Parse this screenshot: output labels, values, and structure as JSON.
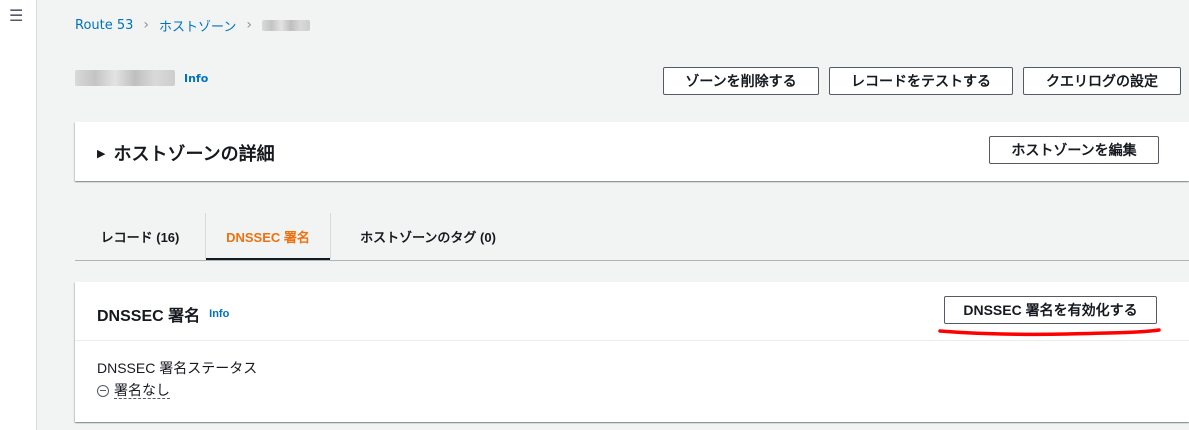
{
  "nav": {
    "menu_icon": "menu-icon"
  },
  "breadcrumb": {
    "items": [
      "Route 53",
      "ホストゾーン"
    ],
    "separator": ">"
  },
  "page": {
    "info_label": "Info"
  },
  "actions": {
    "delete_zone": "ゾーンを削除する",
    "test_record": "レコードをテストする",
    "query_log": "クエリログの設定"
  },
  "details": {
    "title": "ホストゾーンの詳細",
    "edit_button": "ホストゾーンを編集"
  },
  "tabs": [
    {
      "label": "レコード (16)",
      "active": false
    },
    {
      "label": "DNSSEC 署名",
      "active": true
    },
    {
      "label": "ホストゾーンのタグ (0)",
      "active": false
    }
  ],
  "dnssec": {
    "title": "DNSSEC 署名",
    "info_label": "Info",
    "enable_button": "DNSSEC 署名を有効化する",
    "status_label": "DNSSEC 署名ステータス",
    "status_value": "署名なし",
    "status_icon": "minus-circle-icon"
  },
  "colors": {
    "link": "#0073bb",
    "active_tab": "#ec7211",
    "annotation": "#ff0000",
    "background": "#f2f3f3"
  }
}
